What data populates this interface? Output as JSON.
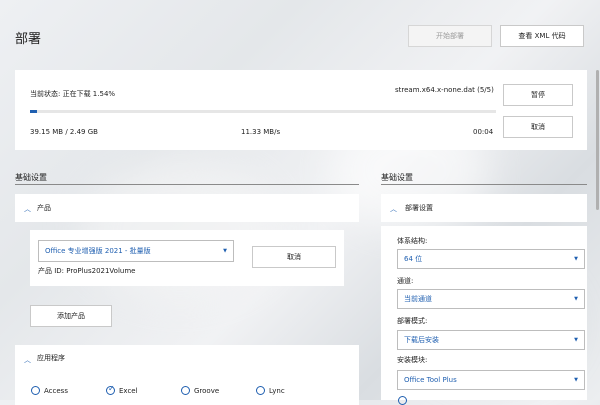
{
  "header": {
    "title": "部署",
    "start_deploy_label": "开始部署",
    "view_xml_label": "查看 XML 代码"
  },
  "download": {
    "status_text": "当前状态: 正在下载  1.54%",
    "file_text": "stream.x64.x-none.dat (5/5)",
    "size_text": "39.15 MB / 2.49 GB",
    "speed_text": "11.33 MB/s",
    "time_text": "00:04",
    "progress_fraction": 0.0154,
    "pause_label": "暂停",
    "cancel_label": "取消"
  },
  "left": {
    "section_title": "基础设置",
    "product_header": "产品",
    "product_select_value": "Office 专业增强版 2021 - 批量版",
    "product_cancel_label": "取消",
    "product_id_text": "产品 ID: ProPlus2021Volume",
    "add_product_label": "添加产品",
    "apps_header": "应用程序",
    "apps": [
      {
        "label": "Access",
        "checked": false
      },
      {
        "label": "Excel",
        "checked": true
      },
      {
        "label": "Groove",
        "checked": false
      },
      {
        "label": "Lync",
        "checked": false
      }
    ]
  },
  "right": {
    "section_title": "基础设置",
    "deploy_header": "部署设置",
    "arch_label": "体系结构:",
    "arch_value": "64 位",
    "channel_label": "通道:",
    "channel_value": "当前通道",
    "mode_label": "部署模式:",
    "mode_value": "下载后安装",
    "module_label": "安装模块:",
    "module_value": "Office Tool Plus"
  },
  "colors": {
    "accent": "#1f5fb0",
    "link": "#1f5fb0"
  }
}
